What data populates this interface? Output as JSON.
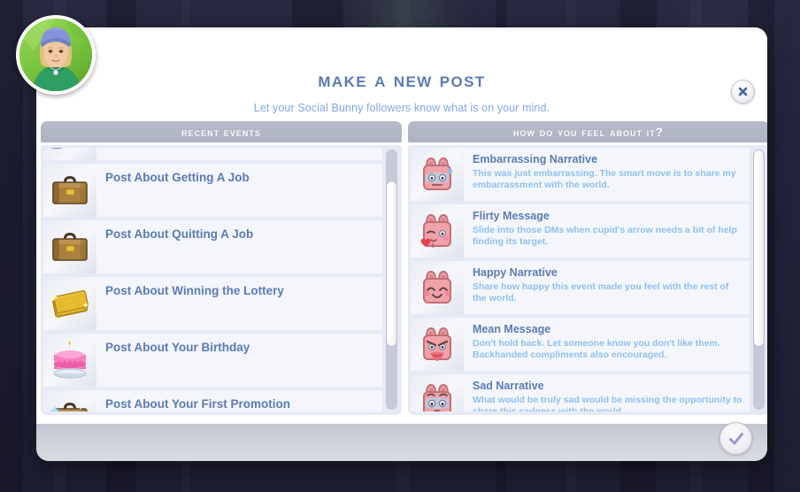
{
  "dialog": {
    "title": "Make A New Post",
    "subtitle": "Let your Social Bunny followers know what is on your mind.",
    "close_label": "Close",
    "confirm_label": "Confirm"
  },
  "avatar": {
    "name": "sim-portrait",
    "background_color": "#7cc63f",
    "hat_color": "#7b8ad6",
    "shirt_color": "#2f9e63",
    "hair_color": "#e0c487"
  },
  "columns": {
    "left": {
      "header": "Recent Events",
      "scroll": {
        "thumb_top_pct": 12,
        "thumb_height_pct": 64
      },
      "items": [
        {
          "label": "",
          "icon": "boomerang-icon",
          "partial": true
        },
        {
          "label": "Post About Getting A Job",
          "icon": "briefcase-icon"
        },
        {
          "label": "Post About Quitting A Job",
          "icon": "briefcase-icon"
        },
        {
          "label": "Post About Winning the Lottery",
          "icon": "money-icon"
        },
        {
          "label": "Post About Your Birthday",
          "icon": "cake-icon"
        },
        {
          "label": "Post About Your First Promotion",
          "icon": "briefcase-sparkle-icon"
        }
      ]
    },
    "right": {
      "header": "How Do You Feel About It?",
      "scroll": {
        "thumb_top_pct": 0,
        "thumb_height_pct": 76
      },
      "items": [
        {
          "title": "Embarrassing Narrative",
          "desc": "This was just embarrassing. The smart move is to share my embarrassment with the world.",
          "icon": "bunny-embarrassed-icon"
        },
        {
          "title": "Flirty Message",
          "desc": "Slide into those DMs when cupid's arrow needs a bit of help finding its target.",
          "icon": "bunny-flirty-icon"
        },
        {
          "title": "Happy Narrative",
          "desc": "Share how happy this event made you feel with the rest of the world.",
          "icon": "bunny-happy-icon"
        },
        {
          "title": "Mean Message",
          "desc": "Don't hold back. Let someone know you don't like them. Backhanded compliments also encouraged.",
          "icon": "bunny-mean-icon"
        },
        {
          "title": "Sad Narrative",
          "desc": "What would be truly sad would be missing the opportunity to share this sadness with the world.",
          "icon": "bunny-sad-icon"
        }
      ]
    }
  },
  "colors": {
    "title_blue": "#5b7bb5",
    "subtitle_blue": "#7fa8e8",
    "desc_blue": "#8fc0ef",
    "header_gray": "#b0b5c4",
    "panel_bg": "#e7eaf6",
    "row_bg": "#f4f6fc",
    "backdrop": "#23233a"
  }
}
